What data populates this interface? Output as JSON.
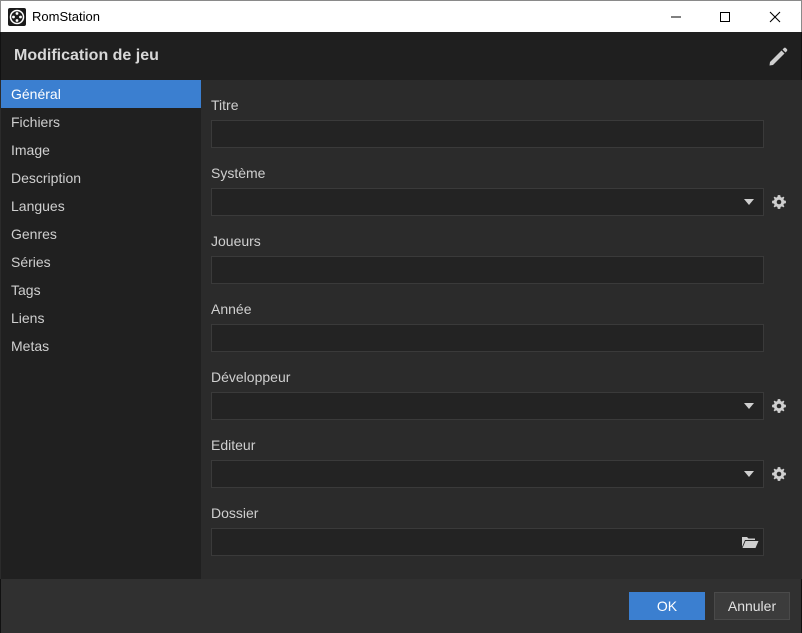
{
  "window": {
    "title": "RomStation"
  },
  "header": {
    "title": "Modification de jeu"
  },
  "sidebar": {
    "items": [
      {
        "label": "Général",
        "active": true
      },
      {
        "label": "Fichiers"
      },
      {
        "label": "Image"
      },
      {
        "label": "Description"
      },
      {
        "label": "Langues"
      },
      {
        "label": "Genres"
      },
      {
        "label": "Séries"
      },
      {
        "label": "Tags"
      },
      {
        "label": "Liens"
      },
      {
        "label": "Metas"
      }
    ]
  },
  "form": {
    "titre": {
      "label": "Titre",
      "value": ""
    },
    "systeme": {
      "label": "Système",
      "value": ""
    },
    "joueurs": {
      "label": "Joueurs",
      "value": ""
    },
    "annee": {
      "label": "Année",
      "value": ""
    },
    "developpeur": {
      "label": "Développeur",
      "value": ""
    },
    "editeur": {
      "label": "Editeur",
      "value": ""
    },
    "dossier": {
      "label": "Dossier",
      "value": ""
    }
  },
  "footer": {
    "ok_label": "OK",
    "cancel_label": "Annuler"
  },
  "colors": {
    "accent": "#3b7fd0",
    "background": "#2b2b2b",
    "sidebar": "#202020",
    "header": "#1f1f1f"
  }
}
